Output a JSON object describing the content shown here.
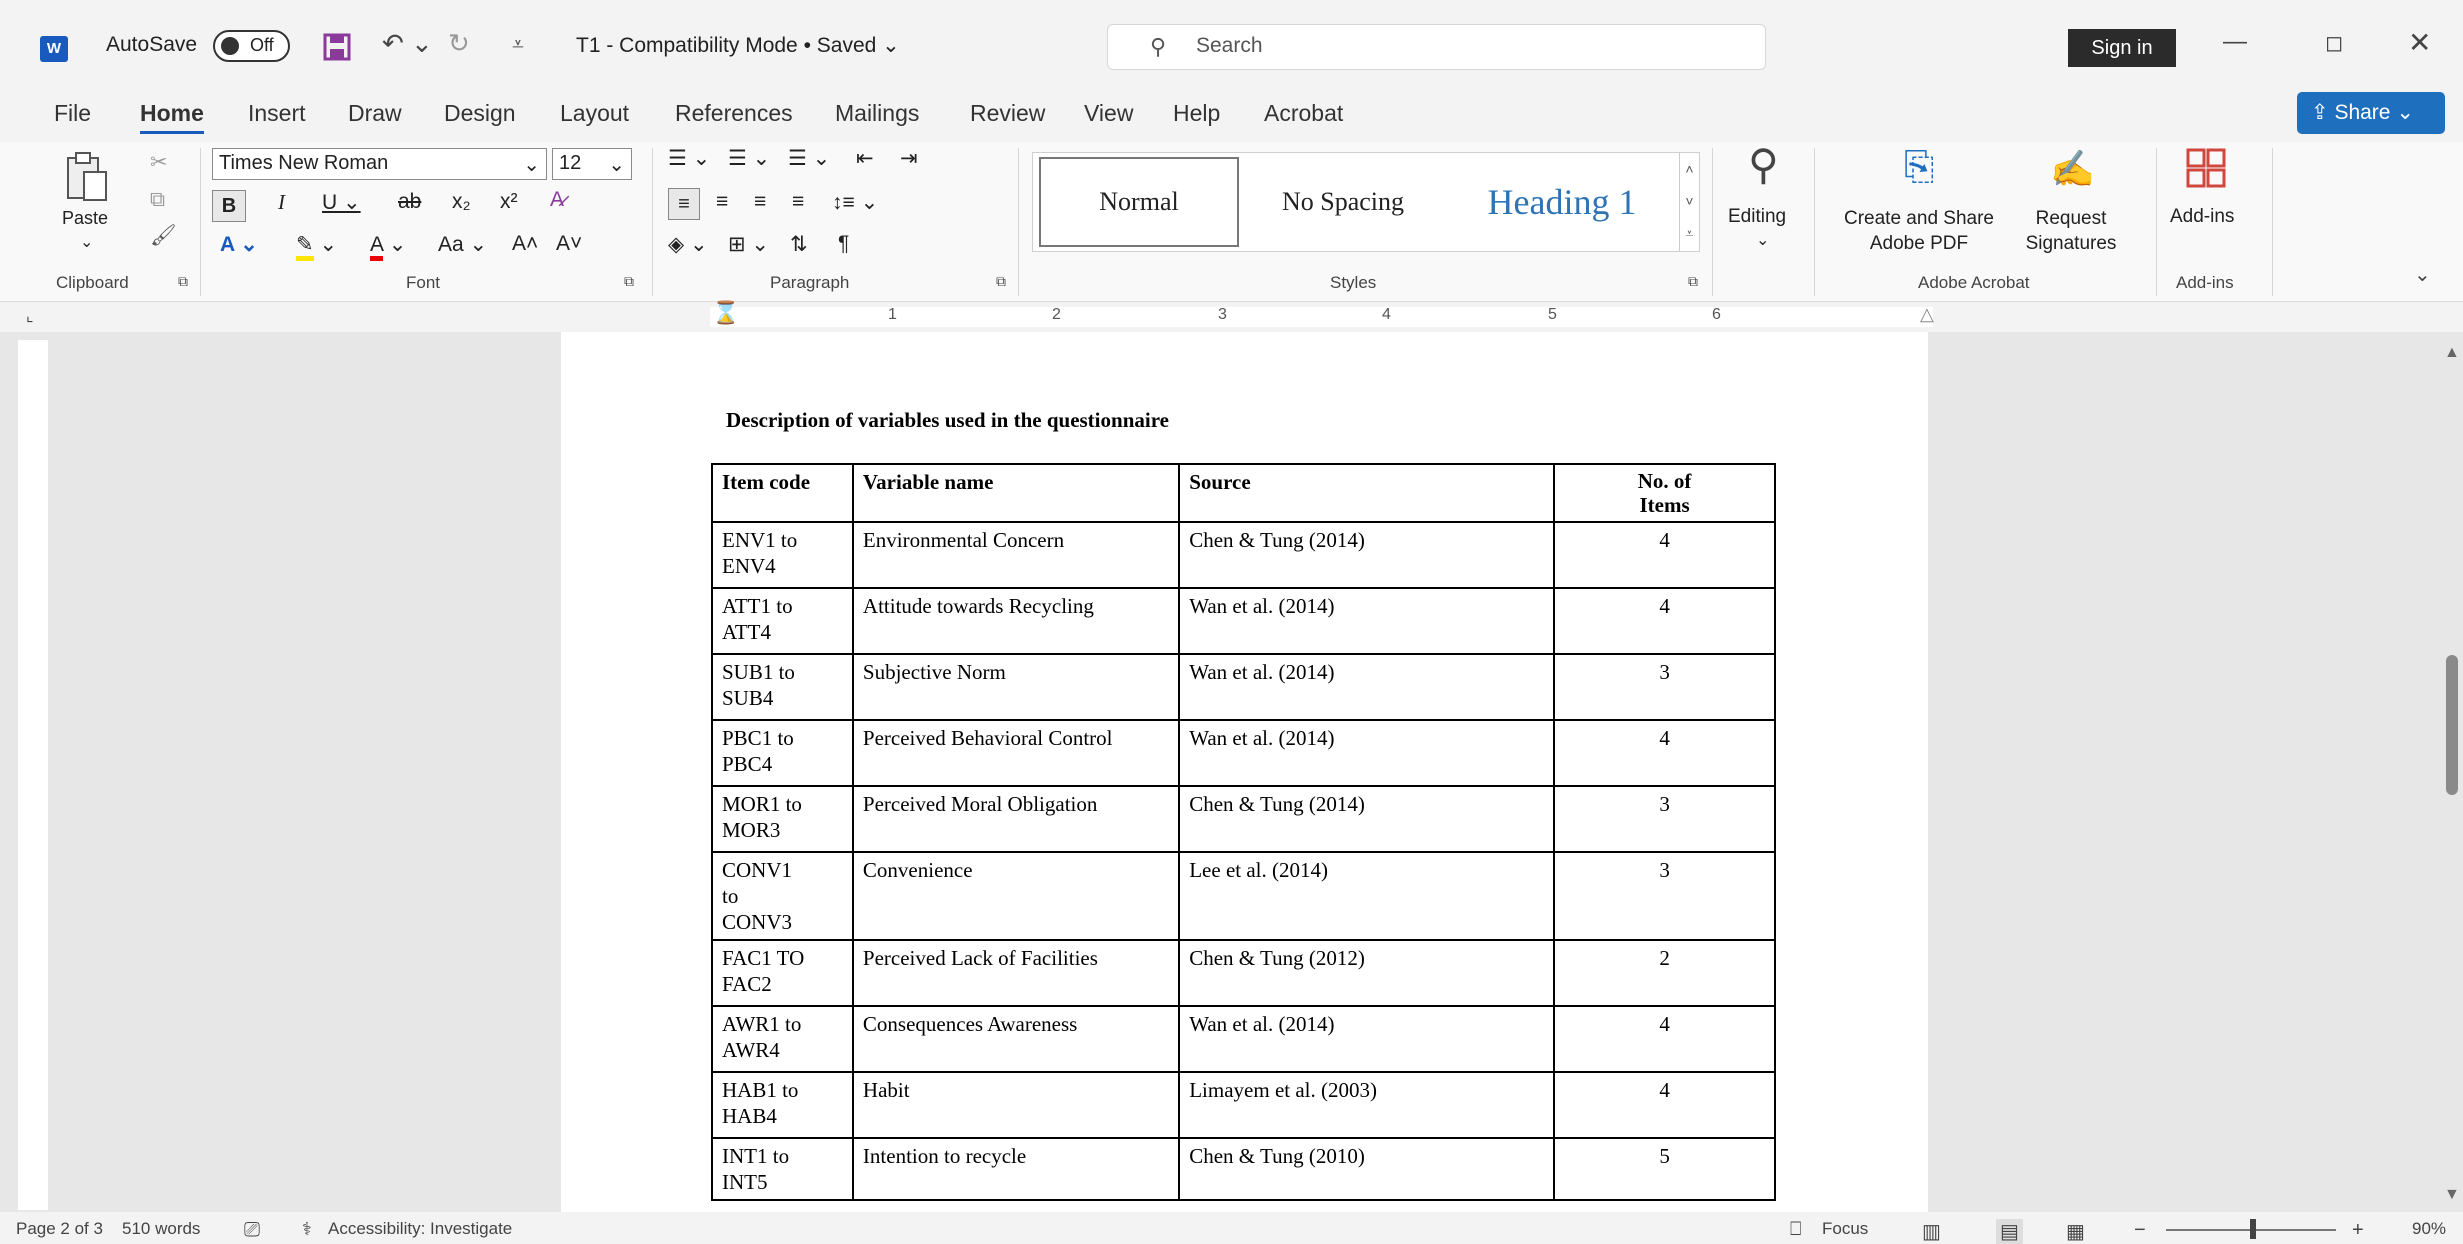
{
  "titlebar": {
    "autosave_label": "AutoSave",
    "autosave_state": "Off",
    "doc_title": "T1 - Compatibility Mode • Saved ⌄",
    "search_placeholder": "Search",
    "signin_label": "Sign in"
  },
  "menu": {
    "tabs": [
      "File",
      "Home",
      "Insert",
      "Draw",
      "Design",
      "Layout",
      "References",
      "Mailings",
      "Review",
      "View",
      "Help",
      "Acrobat"
    ],
    "share_label": "Share"
  },
  "ribbon": {
    "paste_label": "Paste",
    "clipboard_group": "Clipboard",
    "font_name": "Times New Roman",
    "font_size": "12",
    "font_group": "Font",
    "paragraph_group": "Paragraph",
    "styles": {
      "normal": "Normal",
      "no_spacing": "No Spacing",
      "heading1": "Heading 1"
    },
    "styles_group": "Styles",
    "editing_label": "Editing",
    "create_pdf_label": "Create and Share Adobe PDF",
    "request_sig_label": "Request Signatures",
    "acrobat_group": "Adobe Acrobat",
    "addins_label": "Add-ins",
    "addins_group": "Add-ins"
  },
  "ruler": {
    "numbers": [
      "1",
      "2",
      "3",
      "4",
      "5",
      "6"
    ]
  },
  "document": {
    "title": "Description of variables used in the questionnaire",
    "headers": [
      "Item code",
      "Variable name",
      "Source",
      "No. of Items"
    ],
    "rows": [
      [
        "ENV1 to ENV4",
        "Environmental Concern",
        "Chen & Tung (2014)",
        "4"
      ],
      [
        "ATT1 to ATT4",
        "Attitude towards Recycling",
        "Wan et al. (2014)",
        "4"
      ],
      [
        "SUB1 to SUB4",
        "Subjective Norm",
        "Wan et al. (2014)",
        "3"
      ],
      [
        "PBC1 to PBC4",
        "Perceived Behavioral Control",
        "Wan et al. (2014)",
        "4"
      ],
      [
        "MOR1 to MOR3",
        "Perceived Moral Obligation",
        "Chen & Tung (2014)",
        "3"
      ],
      [
        "CONV1 to CONV3",
        "Convenience",
        "Lee et al. (2014)",
        "3"
      ],
      [
        "FAC1 TO FAC2",
        "Perceived Lack of Facilities",
        "Chen & Tung (2012)",
        "2"
      ],
      [
        "AWR1 to AWR4",
        "Consequences Awareness",
        "Wan et al. (2014)",
        "4"
      ],
      [
        "HAB1 to HAB4",
        "Habit",
        "Limayem et al. (2003)",
        "4"
      ],
      [
        "INT1 to INT5",
        "Intention to recycle",
        "Chen & Tung (2010)",
        "5"
      ]
    ]
  },
  "status": {
    "page": "Page 2 of 3",
    "words": "510 words",
    "accessibility": "Accessibility: Investigate",
    "focus": "Focus",
    "zoom": "90%"
  }
}
